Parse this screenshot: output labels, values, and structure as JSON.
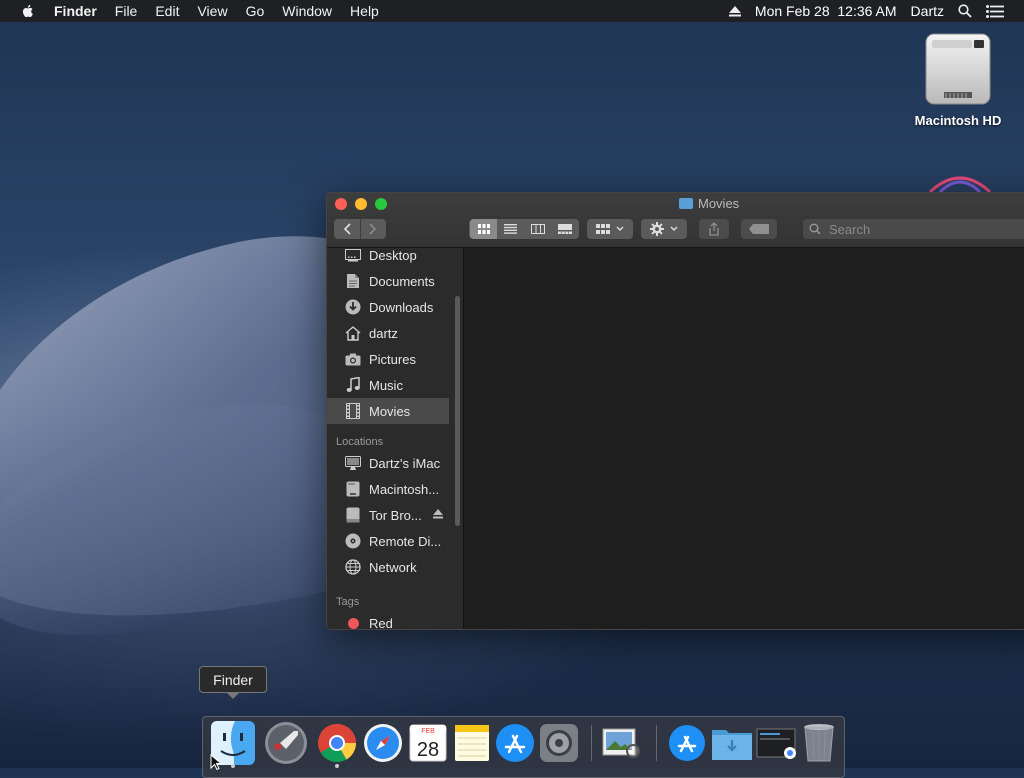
{
  "menubar": {
    "app": "Finder",
    "items": [
      "File",
      "Edit",
      "View",
      "Go",
      "Window",
      "Help"
    ],
    "clock": "Mon Feb 28  12:36 AM",
    "user": "Dartz"
  },
  "desktop": {
    "drive_label": "Macintosh HD"
  },
  "window": {
    "title": "Movies",
    "search_placeholder": "Search"
  },
  "sidebar": {
    "favorites": [
      {
        "label": "Desktop",
        "icon": "desktop-folder-icon"
      },
      {
        "label": "Documents",
        "icon": "documents-icon"
      },
      {
        "label": "Downloads",
        "icon": "downloads-icon"
      },
      {
        "label": "dartz",
        "icon": "home-icon"
      },
      {
        "label": "Pictures",
        "icon": "camera-icon"
      },
      {
        "label": "Music",
        "icon": "music-note-icon"
      },
      {
        "label": "Movies",
        "icon": "film-icon",
        "selected": true
      }
    ],
    "locations_header": "Locations",
    "locations": [
      {
        "label": "Dartz's iMac",
        "icon": "imac-icon"
      },
      {
        "label": "Macintosh...",
        "icon": "hard-drive-icon"
      },
      {
        "label": "Tor Bro...",
        "icon": "disk-image-icon",
        "eject": true
      },
      {
        "label": "Remote Di...",
        "icon": "disc-icon"
      },
      {
        "label": "Network",
        "icon": "globe-icon"
      }
    ],
    "tags_header": "Tags",
    "tags": [
      {
        "label": "Red",
        "color": "#f0555a"
      }
    ]
  },
  "tooltip": {
    "text": "Finder"
  },
  "dock": {
    "items": [
      "Finder",
      "Launchpad",
      "Google Chrome",
      "Safari",
      "Calendar",
      "Notes",
      "App Store",
      "System Preferences",
      "Preview",
      "Applications",
      "Downloads",
      "Screenshot",
      "Trash"
    ],
    "calendar_month": "FEB",
    "calendar_day": "28"
  }
}
